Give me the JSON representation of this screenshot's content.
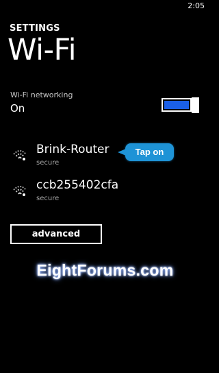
{
  "status_bar": {
    "time": "2:05"
  },
  "header": {
    "section": "SETTINGS",
    "title": "Wi-Fi"
  },
  "wifi_toggle": {
    "label": "Wi-Fi networking",
    "state": "On",
    "enabled": true,
    "accent_color": "#1a5fe8"
  },
  "networks": [
    {
      "name": "Brink-Router",
      "security": "secure",
      "icon": "wifi-signal-icon"
    },
    {
      "name": "ccb255402cfa",
      "security": "secure",
      "icon": "wifi-signal-icon"
    }
  ],
  "callout": {
    "text": "Tap on",
    "color": "#1e93d6"
  },
  "advanced_button": {
    "label": "advanced"
  },
  "watermark": {
    "text": "EightForums.com"
  }
}
